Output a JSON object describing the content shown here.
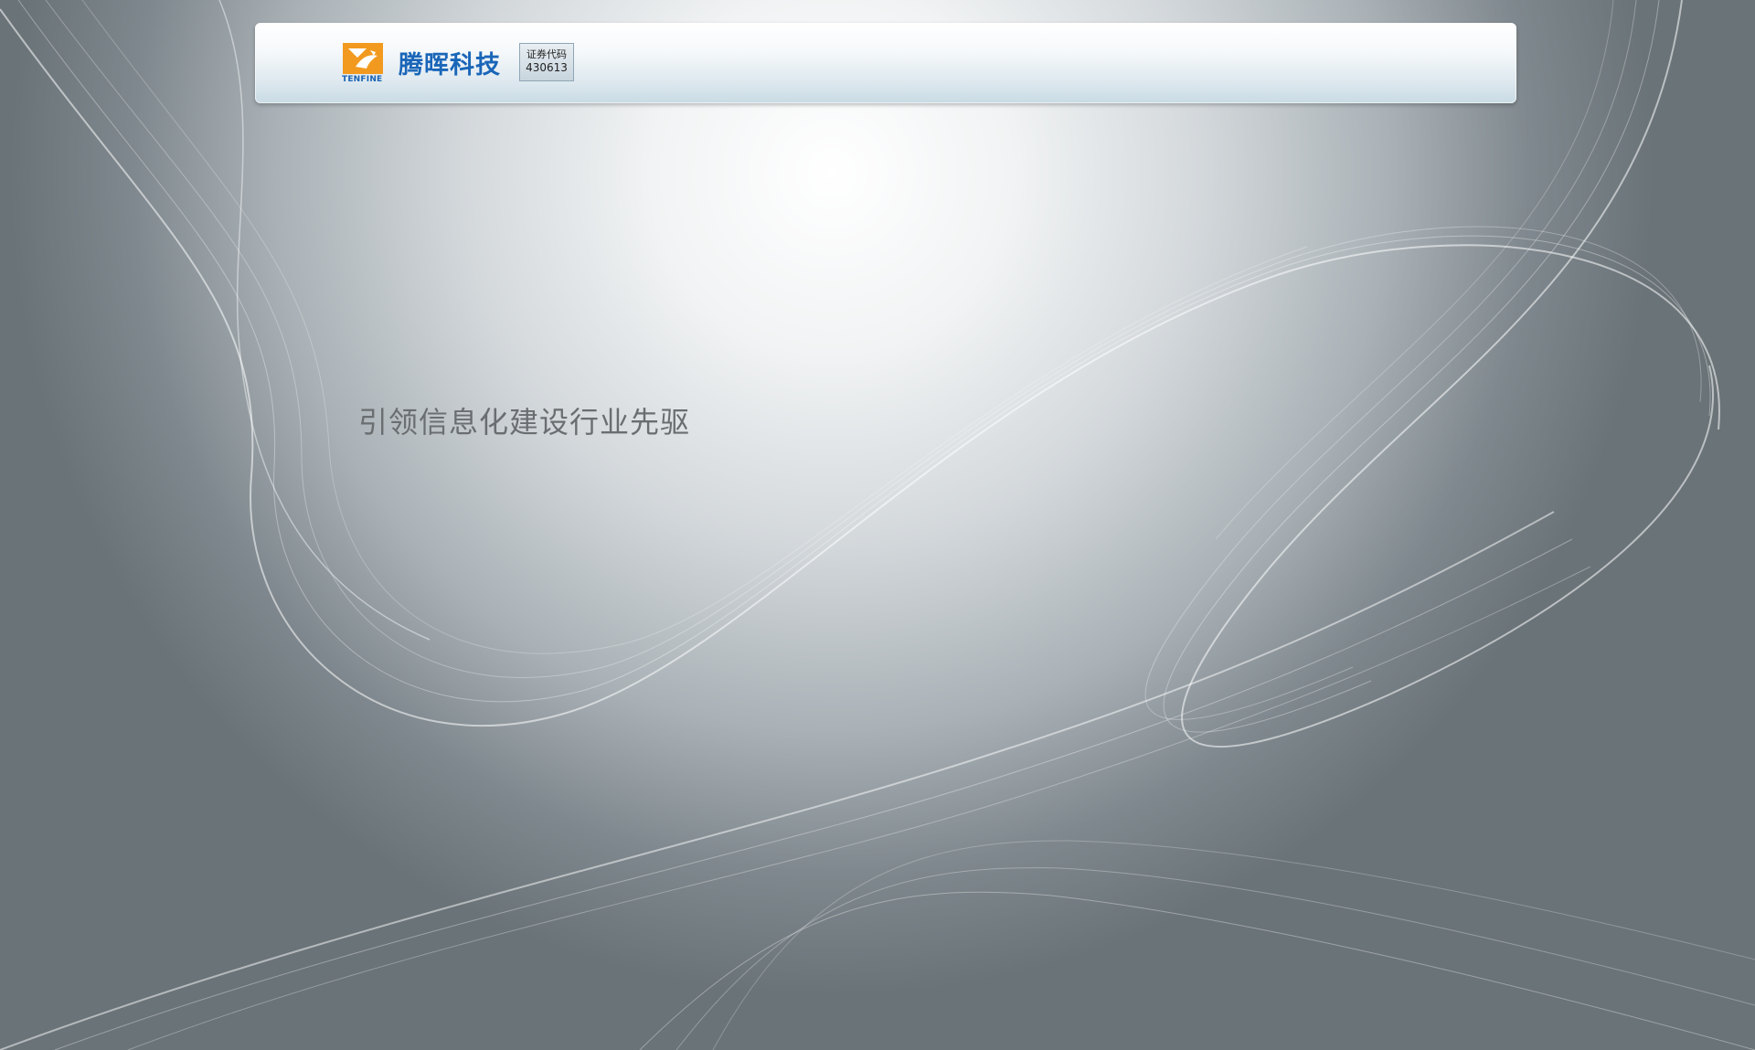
{
  "header": {
    "company_name": "腾晖科技",
    "company_latin": "TENFINE",
    "logo_icon": "tenfine-logo-icon",
    "stock_label": "证券代码",
    "stock_code": "430613"
  },
  "main": {
    "slogan": "引领信息化建设行业先驱"
  },
  "colors": {
    "brand_blue": "#1a66b8",
    "logo_orange": "#f29a1f",
    "slogan_gray": "#6a6e71"
  }
}
